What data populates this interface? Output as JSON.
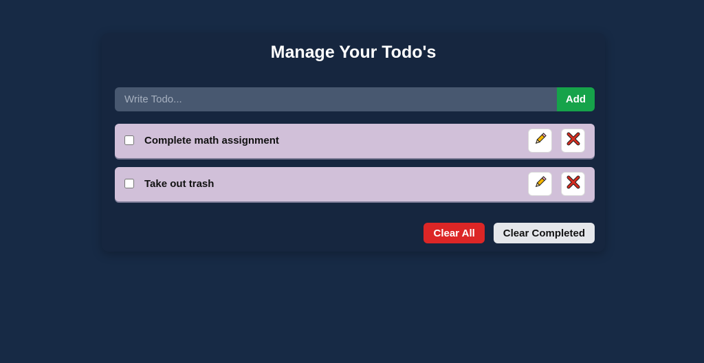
{
  "title": "Manage Your Todo's",
  "input": {
    "placeholder": "Write Todo...",
    "value": ""
  },
  "add_button": "Add",
  "todos": [
    {
      "text": "Complete math assignment",
      "completed": false,
      "edit_icon": "pencil-icon",
      "delete_icon": "cross-icon"
    },
    {
      "text": "Take out trash",
      "completed": false,
      "edit_icon": "pencil-icon",
      "delete_icon": "cross-icon"
    }
  ],
  "footer": {
    "clear_all": "Clear All",
    "clear_completed": "Clear Completed"
  },
  "colors": {
    "background": "#172a45",
    "card": "#16263f",
    "input": "#485870",
    "add": "#16a34a",
    "todo_item": "#d1c0d9",
    "clear_all": "#dc2626",
    "clear_completed": "#e5e7eb"
  }
}
